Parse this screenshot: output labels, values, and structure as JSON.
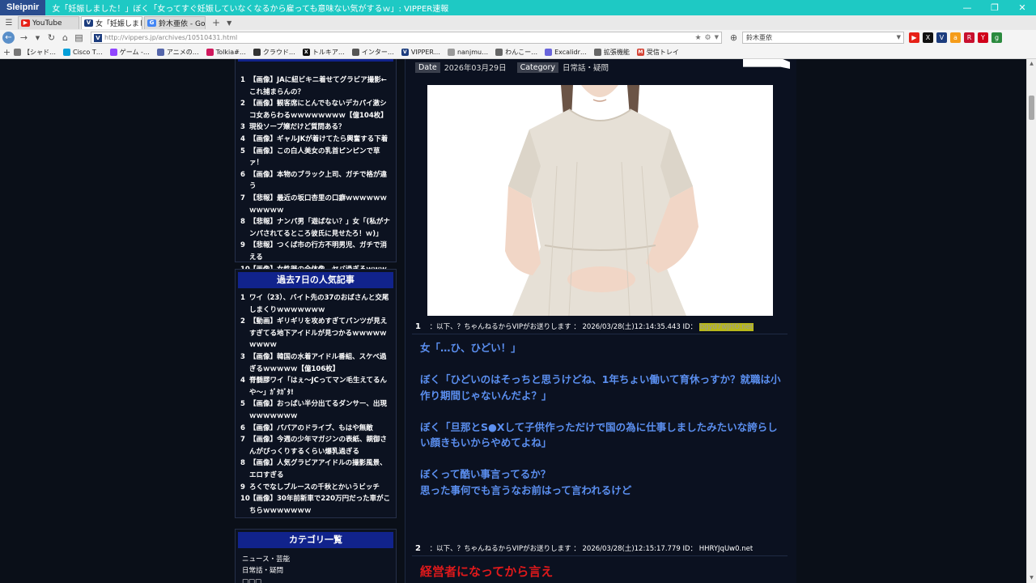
{
  "window": {
    "app_name": "Sleipnir",
    "title": "女「妊娠しました！」ぼく「女ってすぐ妊娠していなくなるから雇っても意味ない気がするｗ」: VIPPER速報"
  },
  "tabs": [
    {
      "label": "YouTube",
      "icon": "youtube-icon",
      "color": "#e62117",
      "active": false
    },
    {
      "label": "女「妊娠しました…",
      "icon": "vipper-icon",
      "color": "#1d3d7e",
      "active": true
    },
    {
      "label": "鈴木亜依 - Goo…",
      "icon": "google-icon",
      "color": "#4285f4",
      "active": false
    }
  ],
  "nav": {
    "url": "http://vippers.jp/archives/10510431.html",
    "search_value": "鈴木亜依"
  },
  "bookmarks": [
    {
      "label": "【シャド…",
      "icon": "bookmark-icon",
      "color": "#777"
    },
    {
      "label": "Cisco T…",
      "icon": "cisco-icon",
      "color": "#049fd9"
    },
    {
      "label": "ゲーム -…",
      "icon": "twitch-icon",
      "color": "#9146ff"
    },
    {
      "label": "アニメの…",
      "icon": "anime-icon",
      "color": "#5566aa"
    },
    {
      "label": "Tolkia#…",
      "icon": "tolkia-icon",
      "color": "#d0185c"
    },
    {
      "label": "クラウド…",
      "icon": "sec-icon",
      "color": "#333"
    },
    {
      "label": "トルキア…",
      "icon": "x-icon",
      "color": "#111"
    },
    {
      "label": "インター…",
      "icon": "uv-icon",
      "color": "#555"
    },
    {
      "label": "VIPPER…",
      "icon": "vipper-icon",
      "color": "#1d3d7e"
    },
    {
      "label": "nanjmu…",
      "icon": "nanj-icon",
      "color": "#999"
    },
    {
      "label": "わんこー…",
      "icon": "wanko-icon",
      "color": "#666"
    },
    {
      "label": "Excalidr…",
      "icon": "excalidraw-icon",
      "color": "#6965db"
    },
    {
      "label": "拡張機能",
      "icon": "puzzle-icon",
      "color": "#666"
    },
    {
      "label": "受信トレイ",
      "icon": "gmail-icon",
      "color": "#d44638"
    }
  ],
  "sidebar": {
    "ranking_top": [
      {
        "num": "1",
        "text": "【画像】JAに紐ビキニ着せてグラビア撮影←これ捕まらんの？"
      },
      {
        "num": "2",
        "text": "【画像】観客席にとんでもないデカパイ激シコ女あらわるｗｗｗｗｗｗｗｗ【億104枚】"
      },
      {
        "num": "3",
        "text": "現役ソープ嬢だけど質問ある？"
      },
      {
        "num": "4",
        "text": "【画像】ギャルJKが着けてたら興奮する下着"
      },
      {
        "num": "5",
        "text": "【画像】この白人美女の乳首ピンピンで草ァ！"
      },
      {
        "num": "6",
        "text": "【画像】本物のブラック上司、ガチで格が違う"
      },
      {
        "num": "7",
        "text": "【悲報】最近の坂口杏里の口癖ｗｗｗｗｗｗｗｗｗｗｗ"
      },
      {
        "num": "8",
        "text": "【悲報】ナンパ男「遊ばない？」女「(私がナンパされてるところ彼氏に見せたろ！ｗ)」"
      },
      {
        "num": "9",
        "text": "【悲報】つくば市の行方不明男児、ガチで消える"
      },
      {
        "num": "10",
        "text": "【画像】女性器の全体像、ヤバ過ぎるｗｗｗｗｗｗ"
      }
    ],
    "weekly_title": "過去7日の人気記事",
    "weekly": [
      {
        "num": "1",
        "text": "ワイ（23）、バイト先の37のおばさんと交尾しまくりｗｗｗｗｗｗｗ"
      },
      {
        "num": "2",
        "text": "【動画】ギリギリを攻めすぎてパンツが見えすぎてる地下アイドルが見つかるｗｗｗｗｗｗｗｗｗ"
      },
      {
        "num": "3",
        "text": "【画像】韓国の水着アイドル番組、スケベ過ぎるｗｗｗｗｗ【億106枚】"
      },
      {
        "num": "4",
        "text": "脊髄膠ワイ「はぇ〜JCってマン毛生えてるんや〜」ｶﾞﾀｶﾞﾀ!"
      },
      {
        "num": "5",
        "text": "【画像】おっぱい半分出てるダンサー、出現ｗｗｗｗｗｗｗ"
      },
      {
        "num": "6",
        "text": "【画像】パパアのドライブ、もはや無敵"
      },
      {
        "num": "7",
        "text": "【画像】今週の少年マガジンの表紙、親御さんがびっくりするくらい爆乳過ぎる"
      },
      {
        "num": "8",
        "text": "【画像】人気グラビアアイドルの撮影風景、エロすぎる"
      },
      {
        "num": "9",
        "text": "ろくでなしブルースの千秋とかいうビッチ"
      },
      {
        "num": "10",
        "text": "【画像】30年前新車で220万円だった車がこちらｗｗｗｗｗｗｗ"
      }
    ],
    "category_title": "カテゴリ一覧",
    "categories": [
      "ニュース・芸能",
      "日常話・疑問",
      "□□□"
    ]
  },
  "article": {
    "date_label": "Date",
    "date_value": "2026年03月29日",
    "category_label": "Category",
    "category_value": "日常話・疑問",
    "res1": {
      "num": "1",
      "header": "：以下、？ちゃんねるからVIPがお送りします ： 2026/03/28(土)12:14:35.443 ID：",
      "id": "bgyd7wJHO.net",
      "lines": [
        "女「…ひ、ひどい！」",
        "",
        "ぼく「ひどいのはそっちと思うけどね、1年ちょい働いて育休っすか？就職は小作り期間じゃないんだよ？」",
        "",
        "ぼく「旦那とS●Xして子供作っただけで国の為に仕事しましたみたいな誇らしい顔きもいからやめてよね」",
        "",
        "ぼくって酷い事言ってるか？",
        "思った事何でも言うなお前はって言われるけど"
      ]
    },
    "res2": {
      "num": "2",
      "header": "：以下、？ちゃんねるからVIPがお送りします ： 2026/03/28(土)12:15:17.779 ID： HHRYJqUw0.net",
      "text": "経営者になってから言え"
    }
  },
  "colors": {
    "accent_title": "#1ec9c4",
    "section_head": "#11238c",
    "res_text": "#5b8ff0",
    "res2_text": "#e0191b"
  }
}
